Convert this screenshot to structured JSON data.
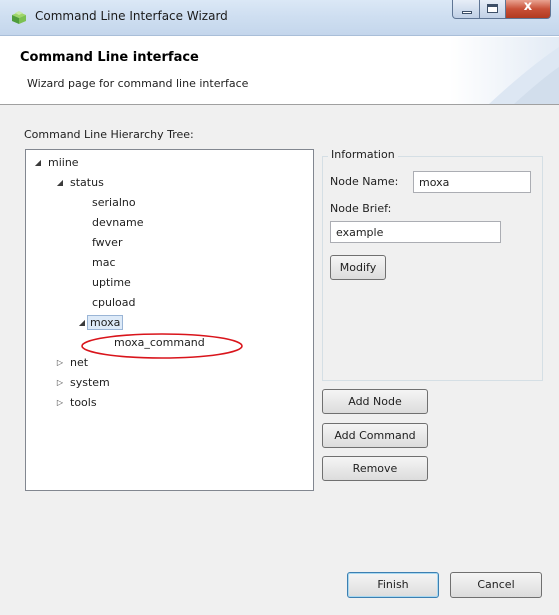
{
  "window": {
    "title": "Command Line Interface Wizard",
    "close_glyph": "x"
  },
  "header": {
    "title": "Command Line interface",
    "subtitle": "Wizard page for command line interface"
  },
  "tree": {
    "label": "Command Line Hierarchy Tree:",
    "root": "miine",
    "status": "status",
    "status_children": [
      "serialno",
      "devname",
      "fwver",
      "mac",
      "uptime",
      "cpuload"
    ],
    "moxa": "moxa",
    "moxa_child": "moxa_command",
    "others": [
      "net",
      "system",
      "tools"
    ]
  },
  "info": {
    "legend": "Information",
    "node_name_label": "Node Name:",
    "node_name_value": "moxa",
    "node_brief_label": "Node Brief:",
    "node_brief_value": "example",
    "modify_label": "Modify"
  },
  "actions": {
    "add_node": "Add Node",
    "add_command": "Add Command",
    "remove": "Remove"
  },
  "footer": {
    "finish": "Finish",
    "cancel": "Cancel"
  },
  "colors": {
    "highlight_ellipse": "#d9141b",
    "selection": "#ddeaf8"
  },
  "icons": {
    "app": "wizard-cube-icon",
    "expanded": "triangle-expanded-icon",
    "collapsed": "triangle-collapsed-icon"
  }
}
